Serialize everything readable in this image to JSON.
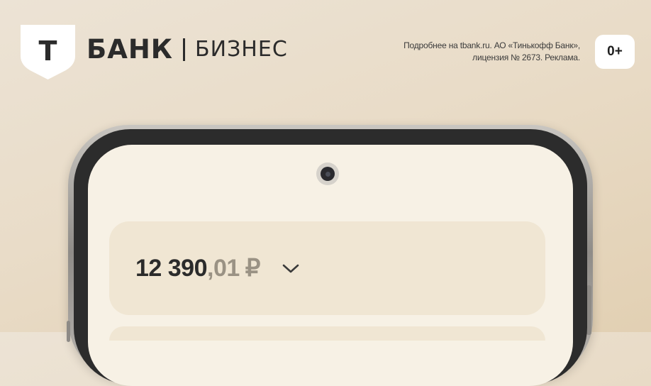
{
  "header": {
    "logo_letter": "Т",
    "brand_bank": "БАНК",
    "brand_business": "БИЗНЕС",
    "disclaimer_line1": "Подробнее на tbank.ru. АО «Тинькофф Банк»,",
    "disclaimer_line2": "лицензия № 2673. Реклама.",
    "age_rating": "0+"
  },
  "phone": {
    "balance_integer": "12 390",
    "balance_fraction": ",01",
    "balance_currency": "₽"
  },
  "colors": {
    "background": "#e9dcc8",
    "shield": "#ffffff",
    "text_dark": "#2b2b2b",
    "screen": "#f7f1e5",
    "card": "#f0e6d3",
    "muted_digits": "#9a9284"
  },
  "icons": {
    "logo": "shield-logo-icon",
    "camera": "camera-icon",
    "chevron": "chevron-down-icon"
  }
}
